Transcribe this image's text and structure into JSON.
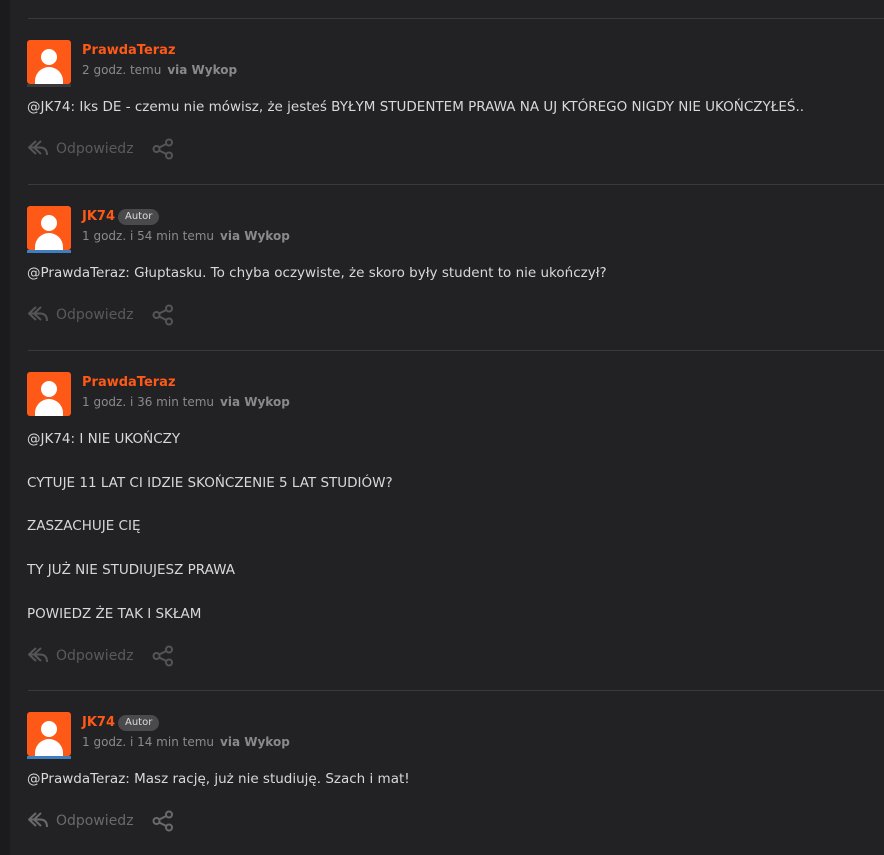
{
  "comments": [
    {
      "author": "PrawdaTeraz",
      "badge": "",
      "time": "2 godz. temu",
      "via": "via Wykop",
      "lines": [
        "@JK74: Iks DE - czemu nie mówisz, że jesteś BYŁYM STUDENTEM PRAWA NA UJ KTÓREGO NIGDY NIE UKOŃCZYŁEŚ.."
      ],
      "reply_label": "Odpowiedz"
    },
    {
      "author": "JK74",
      "badge": "Autor",
      "time": "1 godz. i 54 min temu",
      "via": "via Wykop",
      "lines": [
        "@PrawdaTeraz: Głuptasku. To chyba oczywiste, że skoro były student to nie ukończył?"
      ],
      "reply_label": "Odpowiedz"
    },
    {
      "author": "PrawdaTeraz",
      "badge": "",
      "time": "1 godz. i 36 min temu",
      "via": "via Wykop",
      "lines": [
        "@JK74: I NIE UKOŃCZY",
        "CYTUJE 11 LAT CI IDZIE SKOŃCZENIE 5 LAT STUDIÓW?",
        "ZASZACHUJE CIĘ",
        "TY JUŻ NIE STUDIUJESZ PRAWA",
        "POWIEDZ ŻE TAK I SKŁAM"
      ],
      "reply_label": "Odpowiedz"
    },
    {
      "author": "JK74",
      "badge": "Autor",
      "time": "1 godz. i 14 min temu",
      "via": "via Wykop",
      "lines": [
        "@PrawdaTeraz: Masz rację, już nie studiuję. Szach i mat!"
      ],
      "reply_label": "Odpowiedz"
    }
  ],
  "colors": {
    "accent": "#ff5917",
    "author_line_blue": "#3f7fbf",
    "author_line_dark": "#3a3a3d"
  }
}
